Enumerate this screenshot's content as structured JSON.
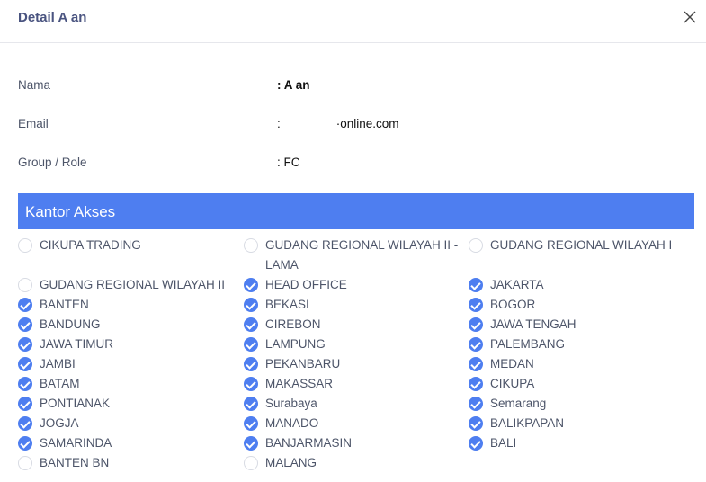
{
  "modal": {
    "title": "Detail A an"
  },
  "fields": [
    {
      "label": "Nama",
      "value": ": A an"
    },
    {
      "label": "Email",
      "value_prefix": ":",
      "value_suffix": "·online.com"
    },
    {
      "label": "Group / Role",
      "value": ": FC"
    }
  ],
  "section": {
    "title": "Kantor Akses"
  },
  "offices": [
    [
      {
        "label": "CIKUPA TRADING",
        "checked": false
      },
      {
        "label": "GUDANG REGIONAL WILAYAH II",
        "checked": false
      },
      {
        "label": "BANTEN",
        "checked": true
      },
      {
        "label": "BANDUNG",
        "checked": true
      },
      {
        "label": "JAWA TIMUR",
        "checked": true
      },
      {
        "label": "JAMBI",
        "checked": true
      },
      {
        "label": "BATAM",
        "checked": true
      },
      {
        "label": "PONTIANAK",
        "checked": true
      },
      {
        "label": "JOGJA",
        "checked": true
      },
      {
        "label": "SAMARINDA",
        "checked": true
      },
      {
        "label": "BANTEN BN",
        "checked": false
      }
    ],
    [
      {
        "label": "GUDANG REGIONAL WILAYAH II - LAMA",
        "checked": false
      },
      {
        "label": "HEAD OFFICE",
        "checked": true
      },
      {
        "label": "BEKASI",
        "checked": true
      },
      {
        "label": "CIREBON",
        "checked": true
      },
      {
        "label": "LAMPUNG",
        "checked": true
      },
      {
        "label": "PEKANBARU",
        "checked": true
      },
      {
        "label": "MAKASSAR",
        "checked": true
      },
      {
        "label": "Surabaya",
        "checked": true
      },
      {
        "label": "MANADO",
        "checked": true
      },
      {
        "label": "BANJARMASIN",
        "checked": true
      },
      {
        "label": "MALANG",
        "checked": false
      }
    ],
    [
      {
        "label": "GUDANG REGIONAL WILAYAH I",
        "checked": false
      },
      {
        "label": "JAKARTA",
        "checked": true
      },
      {
        "label": "BOGOR",
        "checked": true
      },
      {
        "label": "JAWA TENGAH",
        "checked": true
      },
      {
        "label": "PALEMBANG",
        "checked": true
      },
      {
        "label": "MEDAN",
        "checked": true
      },
      {
        "label": "CIKUPA",
        "checked": true
      },
      {
        "label": "Semarang",
        "checked": true
      },
      {
        "label": "BALIKPAPAN",
        "checked": true
      },
      {
        "label": "BALI",
        "checked": true
      }
    ]
  ],
  "icons": {
    "close": "close-icon",
    "checked": "check-circle-icon",
    "unchecked": "empty-circle-icon"
  },
  "colors": {
    "accent": "#4e7ef0",
    "title": "#4a5480",
    "label": "#4d5569"
  }
}
